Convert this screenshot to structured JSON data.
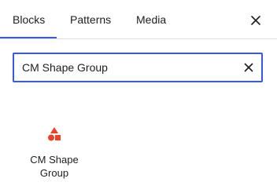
{
  "tabs": {
    "blocks": "Blocks",
    "patterns": "Patterns",
    "media": "Media",
    "active": "Blocks"
  },
  "close_icon": "close-icon",
  "search": {
    "value": "CM Shape Group",
    "clear_icon": "close-icon"
  },
  "results": [
    {
      "label_line1": "CM Shape",
      "label_line2": "Group",
      "icon": "shapes-icon",
      "icon_color": "#e8442b"
    }
  ],
  "colors": {
    "accent": "#3858e9",
    "text": "#1e1e1e",
    "divider": "#e0e0e0"
  }
}
